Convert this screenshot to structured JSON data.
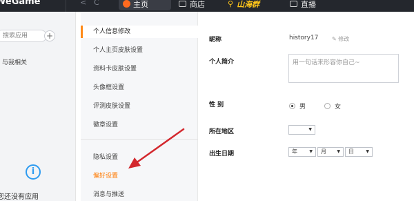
{
  "topbar": {
    "logo": "WeGame",
    "back_glyph": "<",
    "fwd_glyph": "C",
    "tabs": [
      {
        "label": "主页",
        "active": true
      },
      {
        "label": "商店",
        "active": false
      },
      {
        "brand": "山海群",
        "active": false
      },
      {
        "label": "直播",
        "active": false
      }
    ]
  },
  "sidebar": {
    "search_placeholder": "搜索应用",
    "add_label": "+",
    "related_label": "与我相关",
    "empty_text": "您还没有应用"
  },
  "menu": {
    "items": [
      {
        "label": "个人信息修改",
        "active": true
      },
      {
        "label": "个人主页皮肤设置"
      },
      {
        "label": "资料卡皮肤设置"
      },
      {
        "label": "头像框设置"
      },
      {
        "label": "评测皮肤设置"
      },
      {
        "label": "徽章设置"
      },
      {
        "label": "隐私设置"
      },
      {
        "label": "偏好设置",
        "highlight": true
      },
      {
        "label": "消息与推送"
      }
    ]
  },
  "form": {
    "nickname_label": "昵称",
    "nickname_value": "history17",
    "edit_label": "修改",
    "bio_label": "个人简介",
    "bio_placeholder": "用一句话来形容你自己~",
    "gender_label": "性 别",
    "gender_options": [
      {
        "label": "男",
        "checked": true
      },
      {
        "label": "女",
        "checked": false
      }
    ],
    "region_label": "所在地区",
    "region_value": "",
    "birthday_label": "出生日期",
    "year_label": "年",
    "month_label": "月",
    "day_label": "日"
  },
  "colors": {
    "accent": "#ff8a18",
    "highlight_text": "#ff7a00",
    "annotation_arrow": "#d3272d",
    "topbar_bg": "#24272d"
  }
}
